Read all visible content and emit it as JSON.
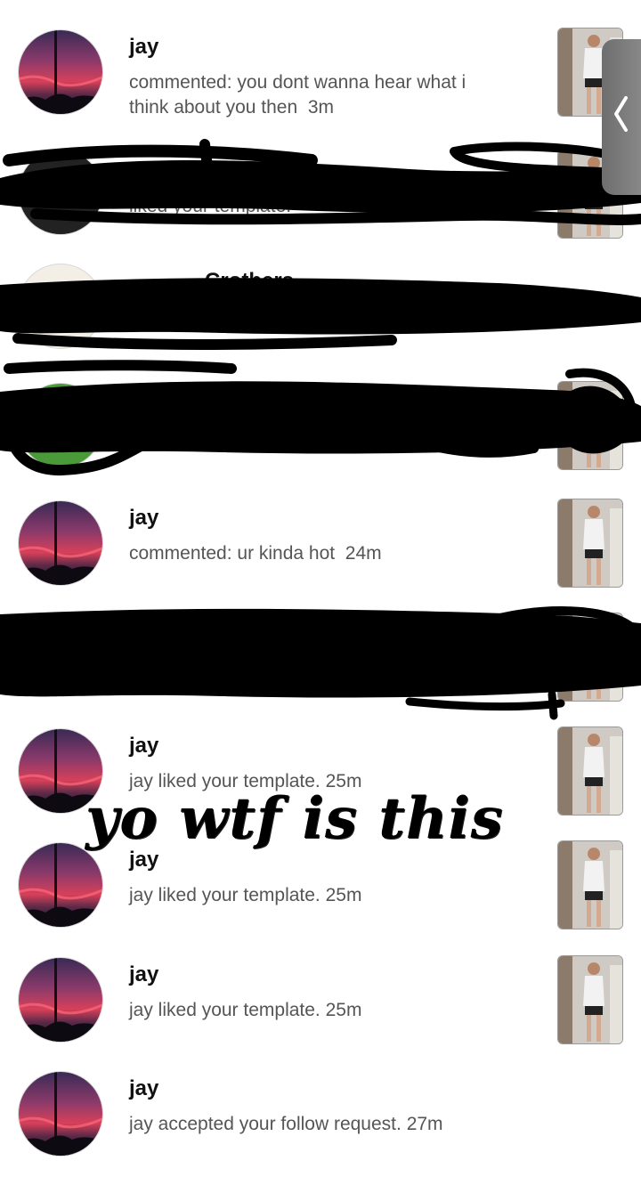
{
  "notifications": [
    {
      "name": "jay",
      "text": "commented: you dont wanna hear what i think about you then",
      "time": "3m"
    },
    {
      "name": "jay",
      "text": "commented: ur kinda hot",
      "time": "24m"
    },
    {
      "name": "jay",
      "text": "jay liked your template.",
      "time": "25m"
    },
    {
      "name": "jay",
      "text": "jay liked your template.",
      "time": "25m"
    },
    {
      "name": "jay",
      "text": "jay liked your template.",
      "time": "25m"
    },
    {
      "name": "jay",
      "text": "jay accepted your follow request.",
      "time": "27m"
    }
  ],
  "redacted_fragments": [
    "liked your template.",
    "Crothers"
  ],
  "overlay_caption": "yo wtf is this",
  "icons": {
    "avatar": "sunset-silhouette-avatar",
    "side_tab": "chevron-left-icon"
  },
  "colors": {
    "background": "#ffffff",
    "name_text": "#111111",
    "message_text": "#555555",
    "scribble": "#000000",
    "side_tab": "#7a7a7a"
  }
}
